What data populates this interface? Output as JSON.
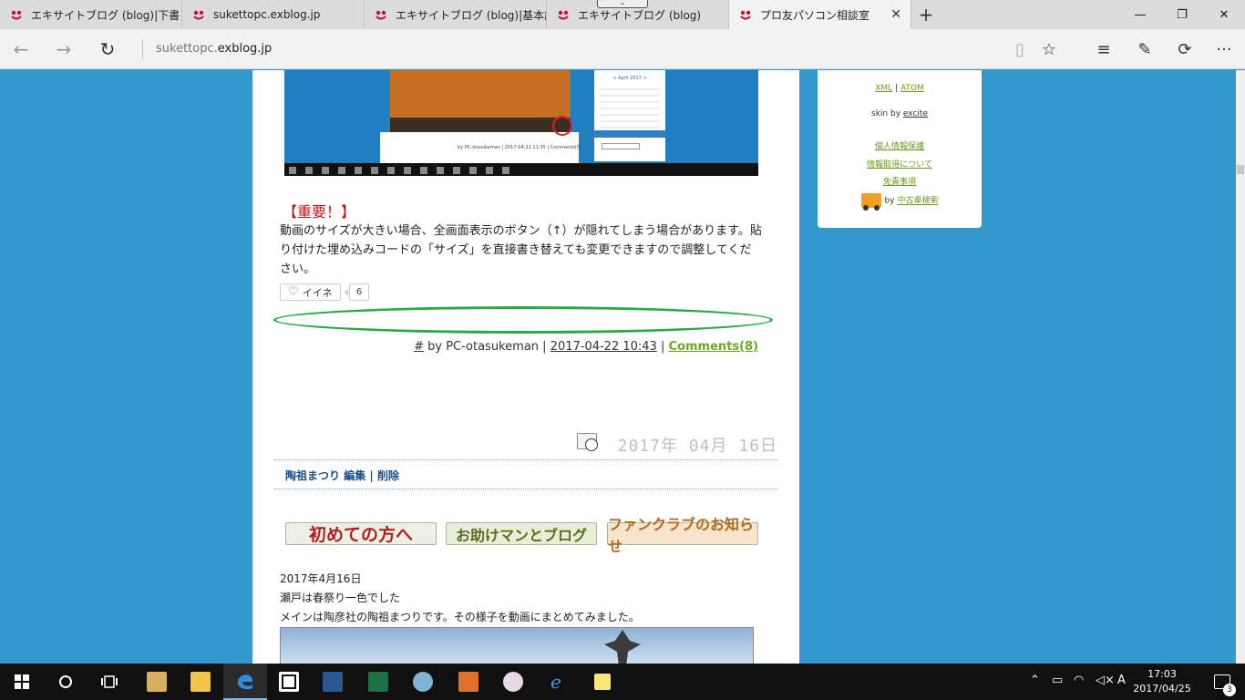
{
  "browser": {
    "tabs": [
      {
        "title": "エキサイトブログ (blog)|下書き",
        "active": false
      },
      {
        "title": "sukettopc.exblog.jp",
        "active": false
      },
      {
        "title": "エキサイトブログ (blog)|基本設",
        "active": false
      },
      {
        "title": "エキサイトブログ (blog)",
        "active": false
      },
      {
        "title": "プロ友パソコン相談室",
        "active": true
      }
    ],
    "close_glyph": "✕",
    "new_tab_glyph": "+",
    "window_controls": {
      "minimize": "—",
      "restore": "❐",
      "close": "✕"
    },
    "url_prefix": "sukettopc.",
    "url_domain": "exblog.jp",
    "nav": {
      "back": "←",
      "forward": "→",
      "refresh": "↻"
    },
    "tools": {
      "reading": "▯",
      "favorite": "☆",
      "hub": "≡",
      "notes": "✎",
      "share": "⟳",
      "more": "···"
    }
  },
  "post": {
    "important_heading": "【重要！】",
    "paragraph": "動画のサイズが大きい場合、全画面表示のボタン（↑）が隠れてしまう場合があります。貼り付けた埋め込みコードの「サイズ」を直接書き替えても変更できますので調整してください。",
    "like_label": "イイネ",
    "like_count": "6",
    "meta": {
      "hash": "#",
      "by": " by PC-otasukeman | ",
      "date": "2017-04-22 10:43",
      "sep": " | ",
      "comments": "Comments(8)"
    },
    "screenshot": {
      "calendar_title": "< April 2017 >",
      "byline": "by PC-otasukeman | 2017-04-21 11:35 | Comments(0)"
    }
  },
  "entry2": {
    "date": "2017年 04月 16日",
    "title": "陶祖まつり",
    "edit": "編集",
    "sep": "|",
    "delete": "削除",
    "banners": [
      "初めての方へ",
      "お助けマンとブログ",
      "ファンクラブのお知らせ"
    ],
    "lines": [
      "2017年4月16日",
      "瀬戸は春祭り一色でした",
      "メインは陶彦社の陶祖まつりです。その様子を動画にまとめてみました。"
    ]
  },
  "sidebar": {
    "feeds_xml": "XML",
    "feeds_sep": " | ",
    "feeds_atom": "ATOM",
    "skin_prefix": "skin by ",
    "skin_link": "excite",
    "privacy": "個人情報保護",
    "info": "情報取得について",
    "disclaimer": "免責事項",
    "by_prefix": "by ",
    "by_link": "中古車検索"
  },
  "taskbar": {
    "clock_time": "17:03",
    "clock_date": "2017/04/25",
    "ime": "A",
    "notifications": "3",
    "colors": {
      "accent": "#7ab8e8",
      "page_bg": "#3399cc"
    }
  }
}
